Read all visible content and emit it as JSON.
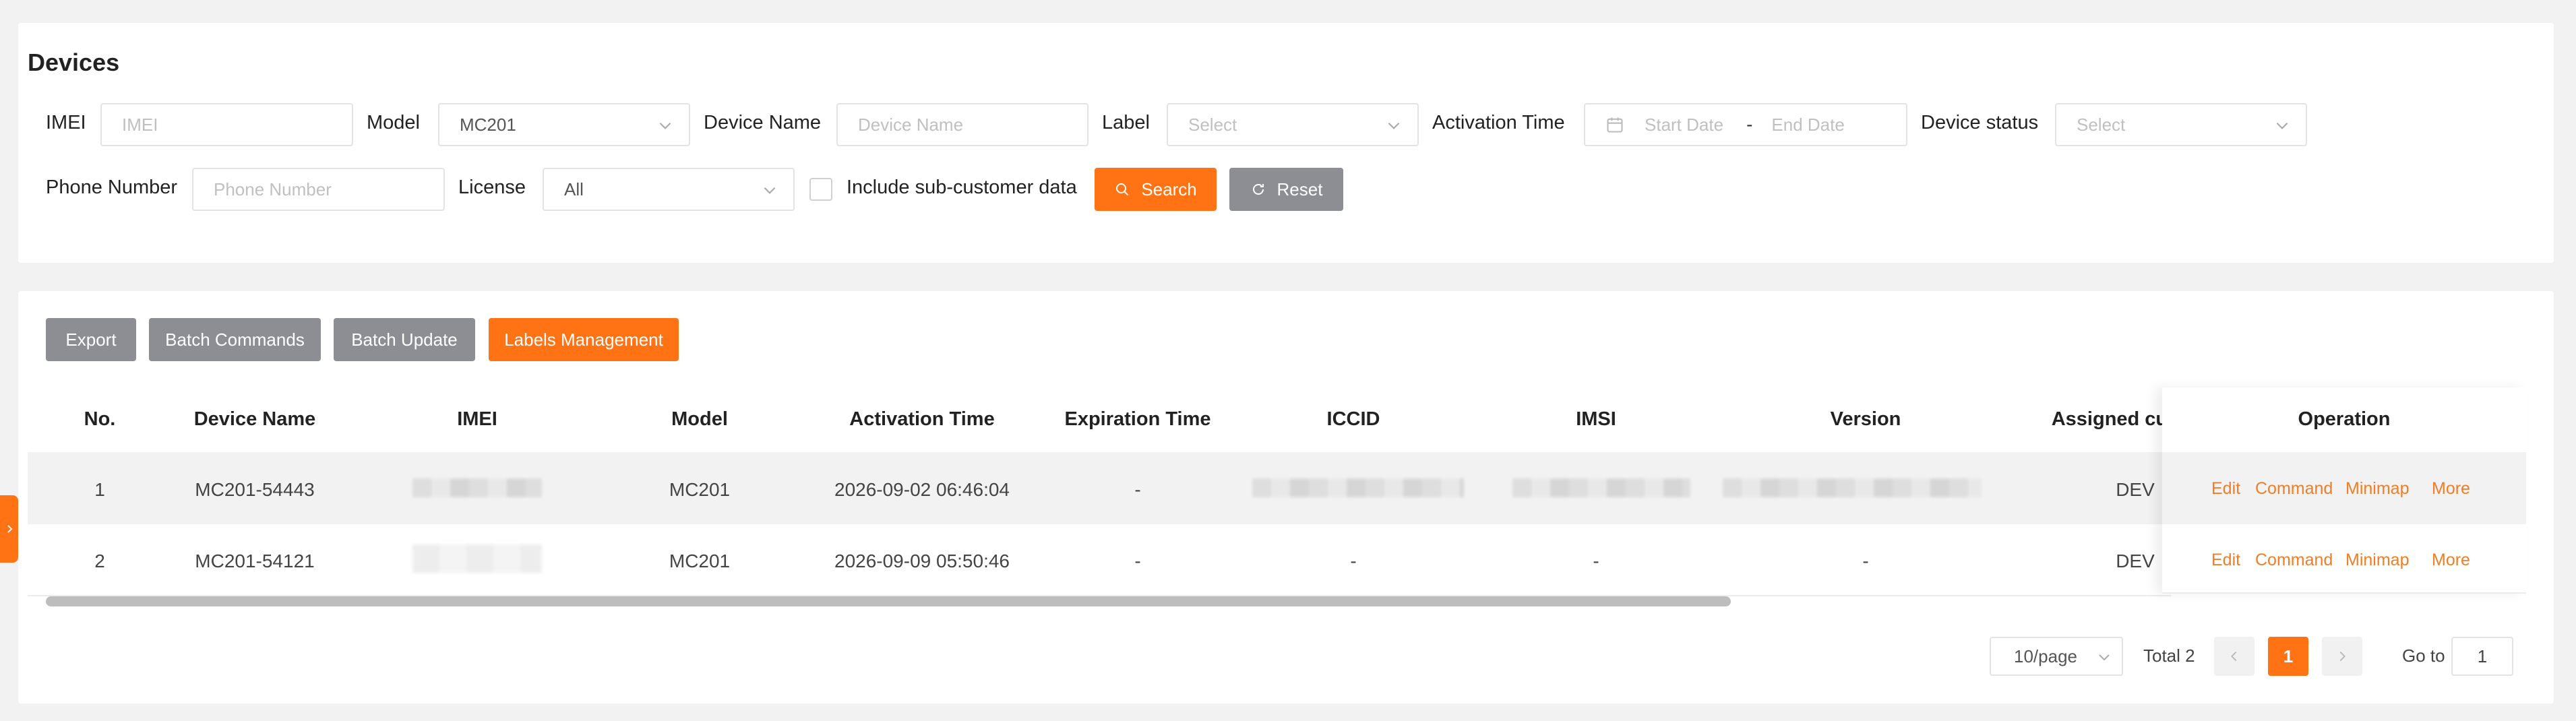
{
  "page": {
    "title": "Devices",
    "accent_color": "#ff7315",
    "link_color": "#f07d27"
  },
  "filters": {
    "imei": {
      "label": "IMEI",
      "placeholder": "IMEI"
    },
    "model": {
      "label": "Model",
      "value": "MC201"
    },
    "device_name": {
      "label": "Device Name",
      "placeholder": "Device Name"
    },
    "label": {
      "label": "Label",
      "placeholder": "Select"
    },
    "activation_time": {
      "label": "Activation Time",
      "start_placeholder": "Start Date",
      "separator": "-",
      "end_placeholder": "End Date"
    },
    "device_status": {
      "label": "Device status",
      "placeholder": "Select"
    },
    "phone_number": {
      "label": "Phone Number",
      "placeholder": "Phone Number"
    },
    "license": {
      "label": "License",
      "value": "All"
    },
    "include_sub": {
      "label": "Include sub-customer data",
      "checked": false
    },
    "search_label": "Search",
    "reset_label": "Reset"
  },
  "toolbar": {
    "export_label": "Export",
    "batch_commands_label": "Batch Commands",
    "batch_update_label": "Batch Update",
    "labels_management_label": "Labels Management"
  },
  "table": {
    "columns": {
      "no": "No.",
      "device_name": "Device Name",
      "imei": "IMEI",
      "model": "Model",
      "activation_time": "Activation Time",
      "expiration_time": "Expiration Time",
      "iccid": "ICCID",
      "imsi": "IMSI",
      "version": "Version",
      "assigned": "Assigned cus",
      "operation": "Operation"
    },
    "rows": [
      {
        "no": "1",
        "device_name": "MC201-54443",
        "model": "MC201",
        "activation_time": "2026-09-02 06:46:04",
        "expiration_time": "-",
        "assigned": "DEV"
      },
      {
        "no": "2",
        "device_name": "MC201-54121",
        "model": "MC201",
        "activation_time": "2026-09-09 05:50:46",
        "expiration_time": "-",
        "iccid": "-",
        "imsi": "-",
        "version": "-",
        "assigned": "DEV"
      }
    ],
    "operations": {
      "edit": "Edit",
      "command": "Command",
      "minimap": "Minimap",
      "more": "More"
    }
  },
  "pagination": {
    "page_size": "10/page",
    "total": "Total 2",
    "current_page": "1",
    "goto_label": "Go to",
    "goto_value": "1"
  },
  "icons": {
    "select_chevron": "chevron-down-icon",
    "calendar": "calendar-icon",
    "search": "search-icon",
    "reset": "refresh-icon",
    "prev": "chevron-left-icon",
    "next": "chevron-right-icon",
    "side_tab": "chevron-right-icon"
  }
}
